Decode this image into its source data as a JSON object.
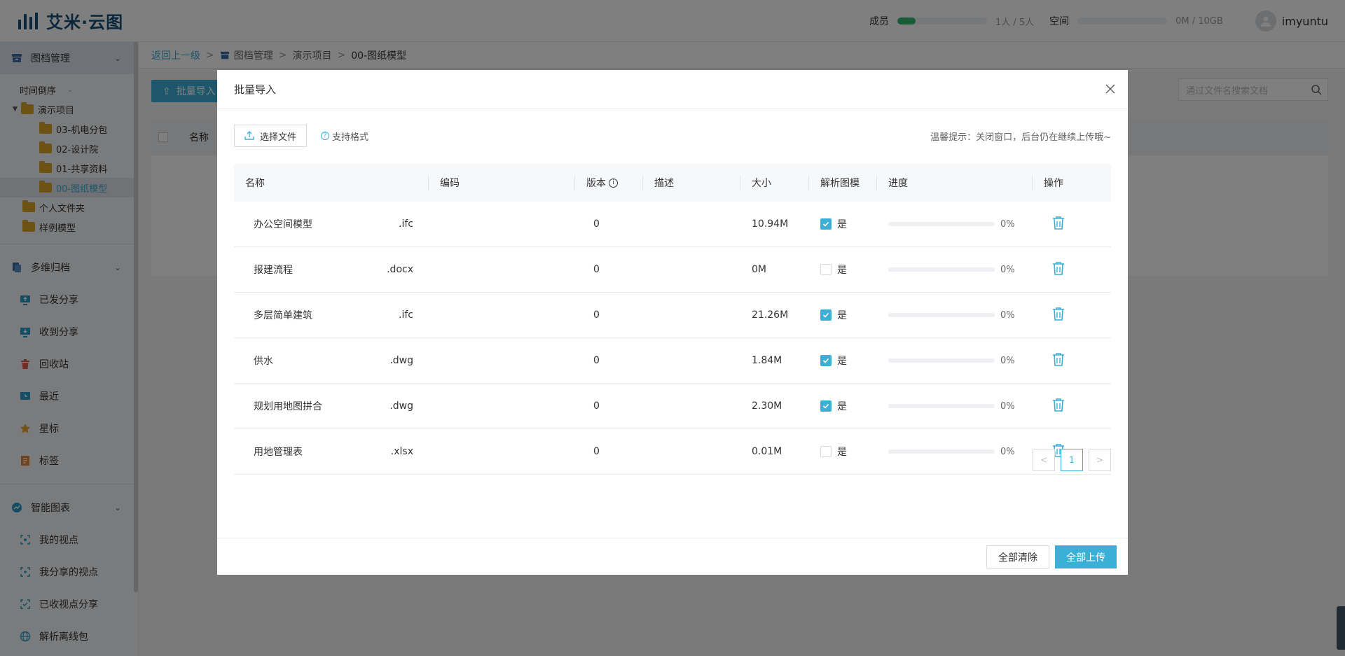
{
  "app": {
    "brand": "艾米·云图"
  },
  "header": {
    "members_label": "成员",
    "members_value": "1人 / 5人",
    "members_fraction": 0.2,
    "space_label": "空间",
    "space_value": "0M / 10GB",
    "space_fraction": 0,
    "username": "imyuntu"
  },
  "sidebar": {
    "group1": "图档管理",
    "sort_label": "时间倒序",
    "tree": {
      "root": "演示项目",
      "children": [
        "03-机电分包",
        "02-设计院",
        "01-共享资料",
        "00-图纸模型"
      ],
      "others": [
        "个人文件夹",
        "样例模型"
      ]
    },
    "group2": "多维归档",
    "group2_items": [
      "已发分享",
      "收到分享",
      "回收站",
      "最近",
      "星标",
      "标签"
    ],
    "group3": "智能图表",
    "group3_items": [
      "我的视点",
      "我分享的视点",
      "已收视点分享",
      "解析离线包"
    ]
  },
  "breadcrumb": {
    "back": "返回上一级",
    "sep": ">",
    "root": "图档管理",
    "project": "演示项目",
    "current": "00-图纸模型"
  },
  "toolbar": {
    "import_label": "批量导入",
    "search_placeholder": "通过文件名搜索文档"
  },
  "bg_table": {
    "name_header": "名称"
  },
  "modal": {
    "title": "批量导入",
    "select_file": "选择文件",
    "support_formats": "支持格式",
    "tip": "温馨提示：关闭窗口，后台仍在继续上传哦~",
    "columns": [
      "名称",
      "编码",
      "版本",
      "描述",
      "大小",
      "解析图模",
      "进度",
      "操作"
    ],
    "rows": [
      {
        "name": "办公空间模型",
        "ext": ".ifc",
        "code": "",
        "version": "0",
        "desc": "",
        "size": "10.94M",
        "parse": true,
        "parse_label": "是",
        "progress": "0%"
      },
      {
        "name": "报建流程",
        "ext": ".docx",
        "code": "",
        "version": "0",
        "desc": "",
        "size": "0M",
        "parse": false,
        "parse_label": "是",
        "progress": "0%"
      },
      {
        "name": "多层简单建筑",
        "ext": ".ifc",
        "code": "",
        "version": "0",
        "desc": "",
        "size": "21.26M",
        "parse": true,
        "parse_label": "是",
        "progress": "0%"
      },
      {
        "name": "供水",
        "ext": ".dwg",
        "code": "",
        "version": "0",
        "desc": "",
        "size": "1.84M",
        "parse": true,
        "parse_label": "是",
        "progress": "0%"
      },
      {
        "name": "规划用地图拼合",
        "ext": ".dwg",
        "code": "",
        "version": "0",
        "desc": "",
        "size": "2.30M",
        "parse": true,
        "parse_label": "是",
        "progress": "0%"
      },
      {
        "name": "用地管理表",
        "ext": ".xlsx",
        "code": "",
        "version": "0",
        "desc": "",
        "size": "0.01M",
        "parse": false,
        "parse_label": "是",
        "progress": "0%"
      }
    ],
    "pager": {
      "prev": "<",
      "page": "1",
      "next": ">"
    },
    "clear_all": "全部清除",
    "upload_all": "全部上传"
  },
  "colors": {
    "accent": "#3cafd6",
    "brand": "#15507a",
    "member_bar": "#32b76d",
    "folder": "#d8a529"
  }
}
